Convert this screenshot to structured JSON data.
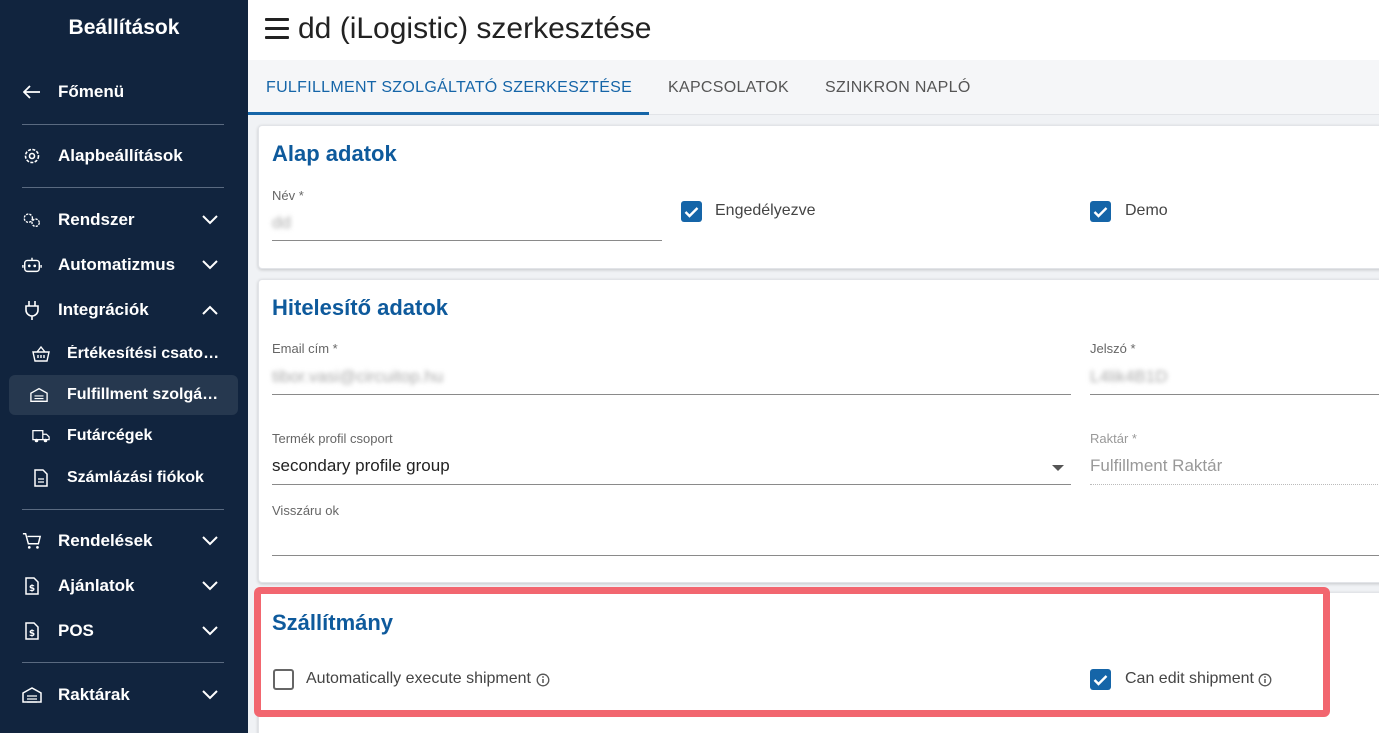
{
  "sidebar": {
    "title": "Beállítások",
    "main_menu": "Főmenü",
    "items": [
      {
        "label": "Alapbeállítások",
        "icon": "gear-icon"
      },
      {
        "label": "Rendszer",
        "icon": "gears-icon"
      },
      {
        "label": "Automatizmus",
        "icon": "robot-icon"
      },
      {
        "label": "Integrációk",
        "icon": "plug-icon"
      }
    ],
    "sub_items": [
      {
        "label": "Értékesítési csatornák",
        "icon": "basket-icon"
      },
      {
        "label": "Fulfillment szolgáltatók",
        "icon": "warehouse-icon"
      },
      {
        "label": "Futárcégek",
        "icon": "truck-icon"
      },
      {
        "label": "Számlázási fiókok",
        "icon": "document-icon"
      }
    ],
    "sections": [
      {
        "label": "Rendelések",
        "icon": "cart-icon"
      },
      {
        "label": "Ajánlatok",
        "icon": "offer-icon"
      },
      {
        "label": "POS",
        "icon": "pos-icon"
      },
      {
        "label": "Raktárak",
        "icon": "warehouse-icon"
      }
    ]
  },
  "header": {
    "title": "dd (iLogistic) szerkesztése"
  },
  "tabs": [
    {
      "label": "FULFILLMENT SZOLGÁLTATÓ SZERKESZTÉSE",
      "active": true
    },
    {
      "label": "KAPCSOLATOK",
      "active": false
    },
    {
      "label": "SZINKRON NAPLÓ",
      "active": false
    }
  ],
  "basic": {
    "title": "Alap adatok",
    "name_label": "Név *",
    "name_value": "dd",
    "enabled_label": "Engedélyezve",
    "enabled": true,
    "demo_label": "Demo",
    "demo": true
  },
  "auth": {
    "title": "Hitelesítő adatok",
    "email_label": "Email cím *",
    "email_value": "tibor.vasi@circuitop.hu",
    "password_label": "Jelszó *",
    "password_value": "L4lik4B1D",
    "profile_group_label": "Termék profil csoport",
    "profile_group_value": "secondary profile group",
    "warehouse_label": "Raktár *",
    "warehouse_value": "Fulfillment Raktár",
    "return_reason_label": "Visszáru ok",
    "return_reason_value": ""
  },
  "shipment": {
    "title": "Szállítmány",
    "auto_execute_label": "Automatically execute shipment",
    "auto_execute": false,
    "can_edit_label": "Can edit shipment",
    "can_edit": true
  },
  "colors": {
    "sidebar_bg": "#11243e",
    "accent": "#1565a8",
    "card_title": "#0e5a9c",
    "highlight": "#f2666f"
  }
}
